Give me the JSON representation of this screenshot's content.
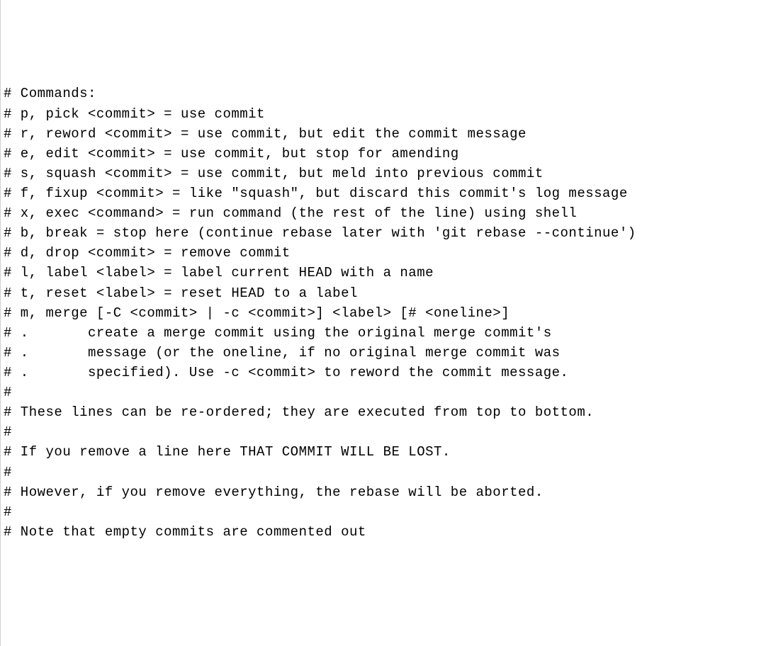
{
  "lines": [
    "# Commands:",
    "# p, pick <commit> = use commit",
    "# r, reword <commit> = use commit, but edit the commit message",
    "# e, edit <commit> = use commit, but stop for amending",
    "# s, squash <commit> = use commit, but meld into previous commit",
    "# f, fixup <commit> = like \"squash\", but discard this commit's log message",
    "# x, exec <command> = run command (the rest of the line) using shell",
    "# b, break = stop here (continue rebase later with 'git rebase --continue')",
    "# d, drop <commit> = remove commit",
    "# l, label <label> = label current HEAD with a name",
    "# t, reset <label> = reset HEAD to a label",
    "# m, merge [-C <commit> | -c <commit>] <label> [# <oneline>]",
    "# .       create a merge commit using the original merge commit's",
    "# .       message (or the oneline, if no original merge commit was",
    "# .       specified). Use -c <commit> to reword the commit message.",
    "#",
    "# These lines can be re-ordered; they are executed from top to bottom.",
    "#",
    "# If you remove a line here THAT COMMIT WILL BE LOST.",
    "#",
    "# However, if you remove everything, the rebase will be aborted.",
    "#",
    "# Note that empty commits are commented out"
  ]
}
